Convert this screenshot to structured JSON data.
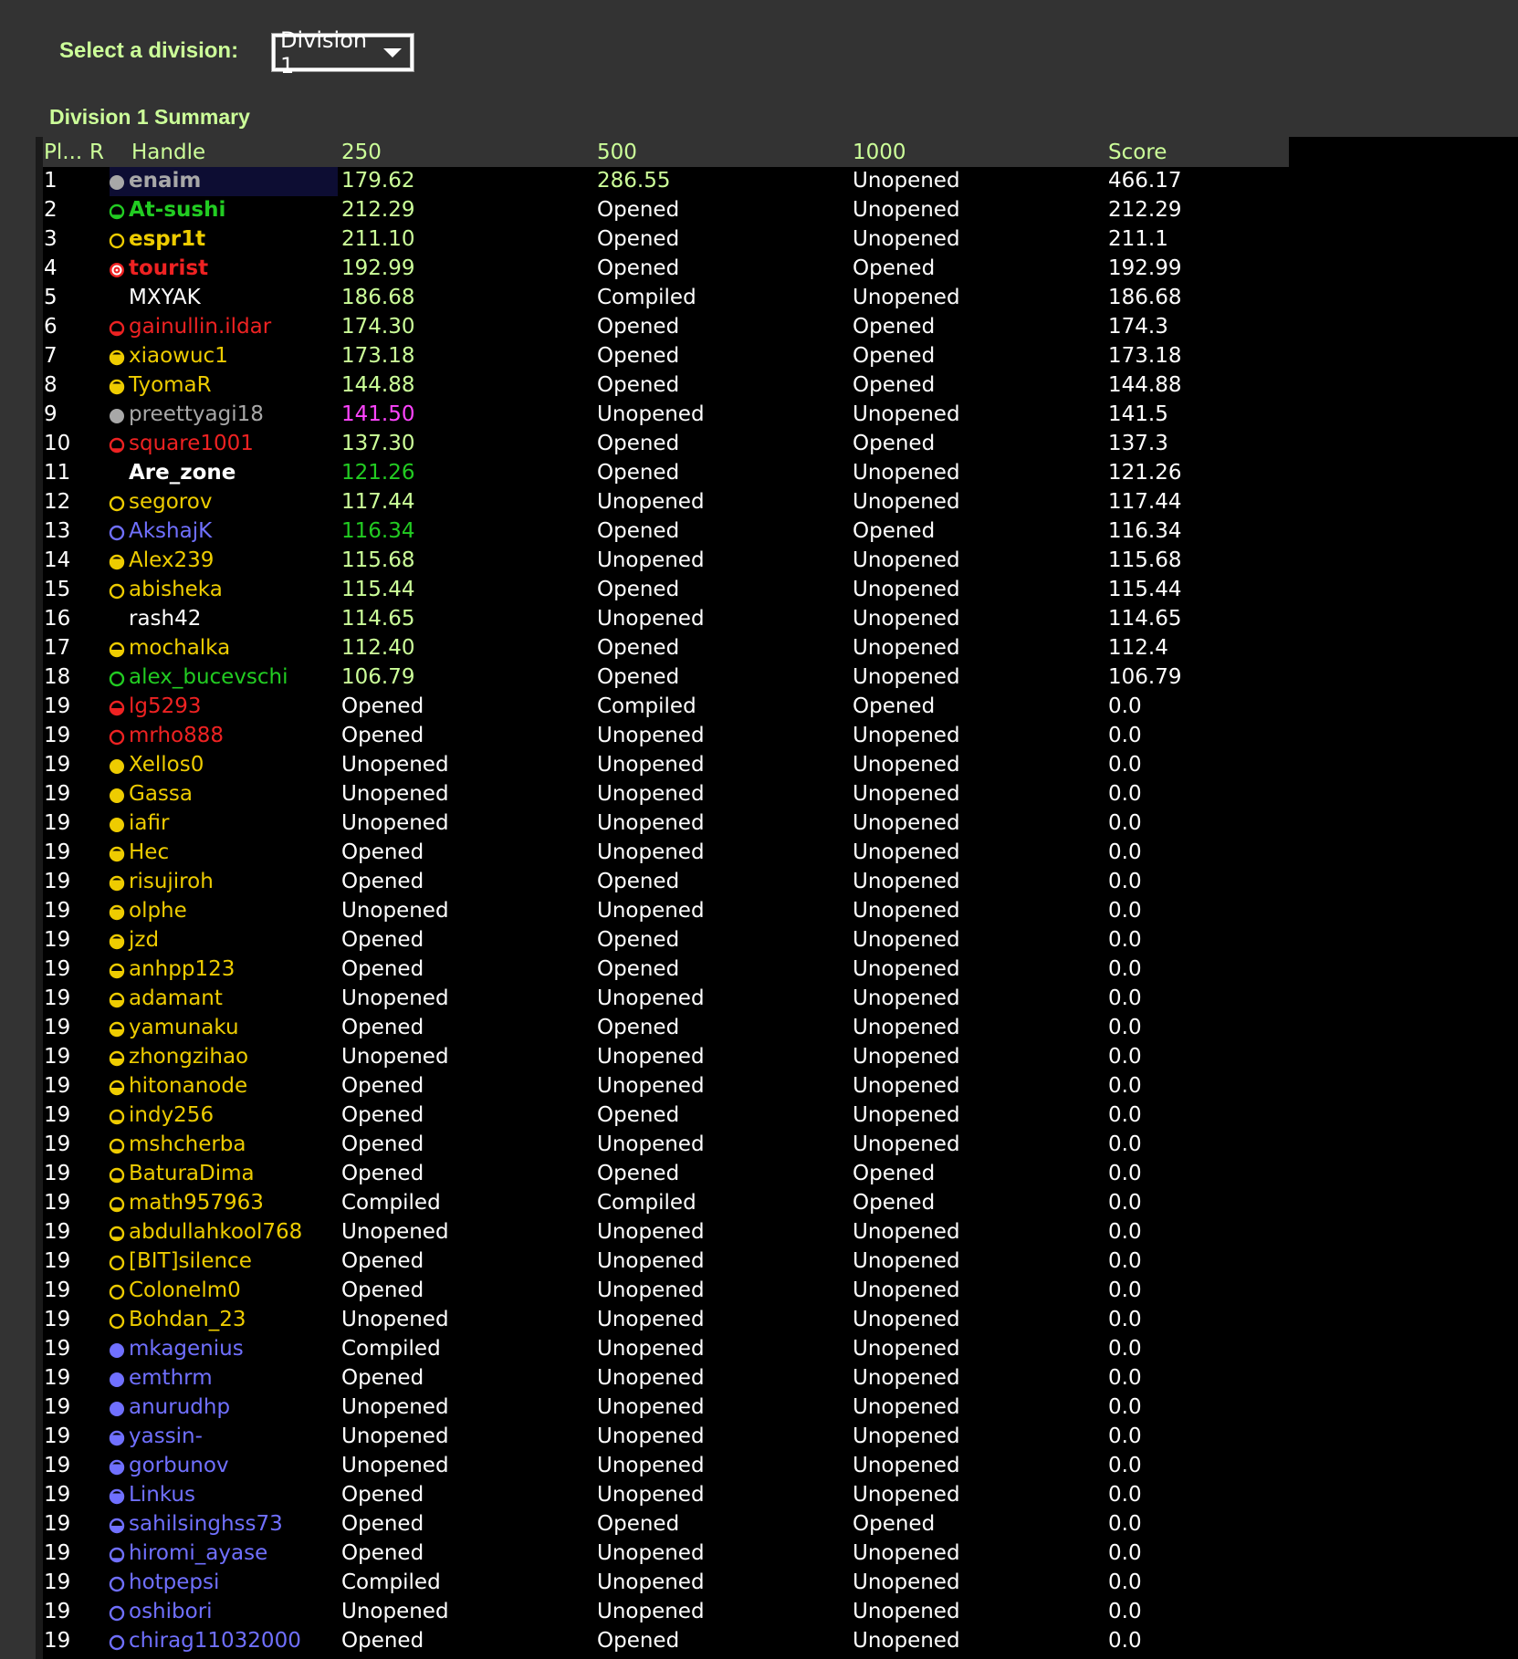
{
  "division_select": {
    "label": "Select a division:",
    "value": "Division 1"
  },
  "summary_title": "Division 1 Summary",
  "columns": [
    "Pl...",
    "R",
    "Handle",
    "250",
    "500",
    "1000",
    "Score"
  ],
  "colors": {
    "gray": "#a8a8a8",
    "green": "#22cc22",
    "yellow": "#eecc00",
    "red": "#ee2222",
    "blue": "#7070ff",
    "white": "#ffffff",
    "magenta": "#ff44ff",
    "text_green": "#ccff99"
  },
  "rows": [
    {
      "place": "1",
      "handle": "enaim",
      "icon": "gray",
      "fill": "full",
      "handle_color": "gray",
      "bold": true,
      "selected": true,
      "p250": "179.62",
      "p250_color": "text_green",
      "p500": "286.55",
      "p500_color": "text_green",
      "p1000": "Unopened",
      "score": "466.17"
    },
    {
      "place": "2",
      "handle": "At-sushi",
      "icon": "green",
      "fill": "top",
      "handle_color": "green",
      "bold": true,
      "p250": "212.29",
      "p250_color": "text_green",
      "p500": "Opened",
      "p1000": "Unopened",
      "score": "212.29"
    },
    {
      "place": "3",
      "handle": "espr1t",
      "icon": "yellow",
      "fill": "none",
      "handle_color": "yellow",
      "bold": true,
      "p250": "211.10",
      "p250_color": "text_green",
      "p500": "Opened",
      "p1000": "Unopened",
      "score": "211.1"
    },
    {
      "place": "4",
      "handle": "tourist",
      "icon": "red",
      "fill": "target",
      "handle_color": "red",
      "bold": true,
      "p250": "192.99",
      "p250_color": "text_green",
      "p500": "Opened",
      "p1000": "Opened",
      "score": "192.99"
    },
    {
      "place": "5",
      "handle": "MXYAK",
      "icon": "",
      "fill": "",
      "handle_color": "white",
      "p250": "186.68",
      "p250_color": "text_green",
      "p500": "Compiled",
      "p1000": "Unopened",
      "score": "186.68"
    },
    {
      "place": "6",
      "handle": "gainullin.ildar",
      "icon": "red",
      "fill": "top",
      "handle_color": "red",
      "p250": "174.30",
      "p250_color": "text_green",
      "p500": "Opened",
      "p1000": "Opened",
      "score": "174.3"
    },
    {
      "place": "7",
      "handle": "xiaowuc1",
      "icon": "yellow",
      "fill": "most",
      "handle_color": "yellow",
      "p250": "173.18",
      "p250_color": "text_green",
      "p500": "Opened",
      "p1000": "Opened",
      "score": "173.18"
    },
    {
      "place": "8",
      "handle": "TyomaR",
      "icon": "yellow",
      "fill": "most",
      "handle_color": "yellow",
      "p250": "144.88",
      "p250_color": "text_green",
      "p500": "Opened",
      "p1000": "Opened",
      "score": "144.88"
    },
    {
      "place": "9",
      "handle": "preettyagi18",
      "icon": "gray",
      "fill": "full",
      "handle_color": "gray",
      "p250": "141.50",
      "p250_color": "magenta",
      "p500": "Unopened",
      "p1000": "Unopened",
      "score": "141.5"
    },
    {
      "place": "10",
      "handle": "square1001",
      "icon": "red",
      "fill": "top",
      "handle_color": "red",
      "p250": "137.30",
      "p250_color": "text_green",
      "p500": "Opened",
      "p1000": "Opened",
      "score": "137.3"
    },
    {
      "place": "11",
      "handle": "Are_zone",
      "icon": "",
      "fill": "",
      "handle_color": "white",
      "bold": true,
      "p250": "121.26",
      "p250_color": "green",
      "p500": "Opened",
      "p1000": "Unopened",
      "score": "121.26"
    },
    {
      "place": "12",
      "handle": "segorov",
      "icon": "yellow",
      "fill": "none",
      "handle_color": "yellow",
      "p250": "117.44",
      "p250_color": "text_green",
      "p500": "Unopened",
      "p1000": "Unopened",
      "score": "117.44"
    },
    {
      "place": "13",
      "handle": "AkshajK",
      "icon": "blue",
      "fill": "none",
      "handle_color": "blue",
      "p250": "116.34",
      "p250_color": "green",
      "p500": "Opened",
      "p1000": "Opened",
      "score": "116.34"
    },
    {
      "place": "14",
      "handle": "Alex239",
      "icon": "yellow",
      "fill": "most",
      "handle_color": "yellow",
      "p250": "115.68",
      "p250_color": "text_green",
      "p500": "Unopened",
      "p1000": "Unopened",
      "score": "115.68"
    },
    {
      "place": "15",
      "handle": "abisheka",
      "icon": "yellow",
      "fill": "none",
      "handle_color": "yellow",
      "p250": "115.44",
      "p250_color": "text_green",
      "p500": "Opened",
      "p1000": "Unopened",
      "score": "115.44"
    },
    {
      "place": "16",
      "handle": "rash42",
      "icon": "",
      "fill": "",
      "handle_color": "white",
      "p250": "114.65",
      "p250_color": "text_green",
      "p500": "Unopened",
      "p1000": "Unopened",
      "score": "114.65"
    },
    {
      "place": "17",
      "handle": "mochalka",
      "icon": "yellow",
      "fill": "half",
      "handle_color": "yellow",
      "p250": "112.40",
      "p250_color": "text_green",
      "p500": "Opened",
      "p1000": "Unopened",
      "score": "112.4"
    },
    {
      "place": "18",
      "handle": "alex_bucevschi",
      "icon": "green",
      "fill": "none",
      "handle_color": "green",
      "p250": "106.79",
      "p250_color": "text_green",
      "p500": "Opened",
      "p1000": "Unopened",
      "score": "106.79"
    },
    {
      "place": "19",
      "handle": "lg5293",
      "icon": "red",
      "fill": "half",
      "handle_color": "red",
      "p250": "Opened",
      "p500": "Compiled",
      "p1000": "Opened",
      "score": "0.0"
    },
    {
      "place": "19",
      "handle": "mrho888",
      "icon": "red",
      "fill": "none",
      "handle_color": "red",
      "p250": "Opened",
      "p500": "Unopened",
      "p1000": "Unopened",
      "score": "0.0"
    },
    {
      "place": "19",
      "handle": "Xellos0",
      "icon": "yellow",
      "fill": "full",
      "handle_color": "yellow",
      "p250": "Unopened",
      "p500": "Unopened",
      "p1000": "Unopened",
      "score": "0.0"
    },
    {
      "place": "19",
      "handle": "Gassa",
      "icon": "yellow",
      "fill": "full",
      "handle_color": "yellow",
      "p250": "Unopened",
      "p500": "Unopened",
      "p1000": "Unopened",
      "score": "0.0"
    },
    {
      "place": "19",
      "handle": "iafir",
      "icon": "yellow",
      "fill": "full",
      "handle_color": "yellow",
      "p250": "Unopened",
      "p500": "Unopened",
      "p1000": "Unopened",
      "score": "0.0"
    },
    {
      "place": "19",
      "handle": "Hec",
      "icon": "yellow",
      "fill": "most",
      "handle_color": "yellow",
      "p250": "Opened",
      "p500": "Unopened",
      "p1000": "Unopened",
      "score": "0.0"
    },
    {
      "place": "19",
      "handle": "risujiroh",
      "icon": "yellow",
      "fill": "most",
      "handle_color": "yellow",
      "p250": "Opened",
      "p500": "Opened",
      "p1000": "Unopened",
      "score": "0.0"
    },
    {
      "place": "19",
      "handle": "olphe",
      "icon": "yellow",
      "fill": "most",
      "handle_color": "yellow",
      "p250": "Unopened",
      "p500": "Unopened",
      "p1000": "Unopened",
      "score": "0.0"
    },
    {
      "place": "19",
      "handle": "jzd",
      "icon": "yellow",
      "fill": "most",
      "handle_color": "yellow",
      "p250": "Opened",
      "p500": "Opened",
      "p1000": "Unopened",
      "score": "0.0"
    },
    {
      "place": "19",
      "handle": "anhpp123",
      "icon": "yellow",
      "fill": "half",
      "handle_color": "yellow",
      "p250": "Opened",
      "p500": "Opened",
      "p1000": "Unopened",
      "score": "0.0"
    },
    {
      "place": "19",
      "handle": "adamant",
      "icon": "yellow",
      "fill": "half",
      "handle_color": "yellow",
      "p250": "Unopened",
      "p500": "Unopened",
      "p1000": "Unopened",
      "score": "0.0"
    },
    {
      "place": "19",
      "handle": "yamunaku",
      "icon": "yellow",
      "fill": "half",
      "handle_color": "yellow",
      "p250": "Opened",
      "p500": "Opened",
      "p1000": "Unopened",
      "score": "0.0"
    },
    {
      "place": "19",
      "handle": "zhongzihao",
      "icon": "yellow",
      "fill": "half",
      "handle_color": "yellow",
      "p250": "Unopened",
      "p500": "Unopened",
      "p1000": "Unopened",
      "score": "0.0"
    },
    {
      "place": "19",
      "handle": "hitonanode",
      "icon": "yellow",
      "fill": "half",
      "handle_color": "yellow",
      "p250": "Opened",
      "p500": "Unopened",
      "p1000": "Unopened",
      "score": "0.0"
    },
    {
      "place": "19",
      "handle": "indy256",
      "icon": "yellow",
      "fill": "top",
      "handle_color": "yellow",
      "p250": "Opened",
      "p500": "Opened",
      "p1000": "Unopened",
      "score": "0.0"
    },
    {
      "place": "19",
      "handle": "mshcherba",
      "icon": "yellow",
      "fill": "top",
      "handle_color": "yellow",
      "p250": "Opened",
      "p500": "Unopened",
      "p1000": "Unopened",
      "score": "0.0"
    },
    {
      "place": "19",
      "handle": "BaturaDima",
      "icon": "yellow",
      "fill": "top",
      "handle_color": "yellow",
      "p250": "Opened",
      "p500": "Opened",
      "p1000": "Opened",
      "score": "0.0"
    },
    {
      "place": "19",
      "handle": "math957963",
      "icon": "yellow",
      "fill": "top",
      "handle_color": "yellow",
      "p250": "Compiled",
      "p500": "Compiled",
      "p1000": "Opened",
      "score": "0.0"
    },
    {
      "place": "19",
      "handle": "abdullahkool768",
      "icon": "yellow",
      "fill": "top",
      "handle_color": "yellow",
      "p250": "Unopened",
      "p500": "Unopened",
      "p1000": "Unopened",
      "score": "0.0"
    },
    {
      "place": "19",
      "handle": "[BIT]silence",
      "icon": "yellow",
      "fill": "none",
      "handle_color": "yellow",
      "p250": "Opened",
      "p500": "Unopened",
      "p1000": "Unopened",
      "score": "0.0"
    },
    {
      "place": "19",
      "handle": "Colonelm0",
      "icon": "yellow",
      "fill": "none",
      "handle_color": "yellow",
      "p250": "Opened",
      "p500": "Unopened",
      "p1000": "Unopened",
      "score": "0.0"
    },
    {
      "place": "19",
      "handle": "Bohdan_23",
      "icon": "yellow",
      "fill": "none",
      "handle_color": "yellow",
      "p250": "Unopened",
      "p500": "Unopened",
      "p1000": "Unopened",
      "score": "0.0"
    },
    {
      "place": "19",
      "handle": "mkagenius",
      "icon": "blue",
      "fill": "full",
      "handle_color": "blue",
      "p250": "Compiled",
      "p500": "Unopened",
      "p1000": "Unopened",
      "score": "0.0"
    },
    {
      "place": "19",
      "handle": "emthrm",
      "icon": "blue",
      "fill": "full",
      "handle_color": "blue",
      "p250": "Opened",
      "p500": "Unopened",
      "p1000": "Unopened",
      "score": "0.0"
    },
    {
      "place": "19",
      "handle": "anurudhp",
      "icon": "blue",
      "fill": "full",
      "handle_color": "blue",
      "p250": "Unopened",
      "p500": "Unopened",
      "p1000": "Unopened",
      "score": "0.0"
    },
    {
      "place": "19",
      "handle": "yassin-",
      "icon": "blue",
      "fill": "most",
      "handle_color": "blue",
      "p250": "Unopened",
      "p500": "Unopened",
      "p1000": "Unopened",
      "score": "0.0"
    },
    {
      "place": "19",
      "handle": "gorbunov",
      "icon": "blue",
      "fill": "most",
      "handle_color": "blue",
      "p250": "Unopened",
      "p500": "Unopened",
      "p1000": "Unopened",
      "score": "0.0"
    },
    {
      "place": "19",
      "handle": "Linkus",
      "icon": "blue",
      "fill": "most",
      "handle_color": "blue",
      "p250": "Opened",
      "p500": "Unopened",
      "p1000": "Unopened",
      "score": "0.0"
    },
    {
      "place": "19",
      "handle": "sahilsinghss73",
      "icon": "blue",
      "fill": "half",
      "handle_color": "blue",
      "p250": "Opened",
      "p500": "Opened",
      "p1000": "Opened",
      "score": "0.0"
    },
    {
      "place": "19",
      "handle": "hiromi_ayase",
      "icon": "blue",
      "fill": "top",
      "handle_color": "blue",
      "p250": "Opened",
      "p500": "Unopened",
      "p1000": "Unopened",
      "score": "0.0"
    },
    {
      "place": "19",
      "handle": "hotpepsi",
      "icon": "blue",
      "fill": "none",
      "handle_color": "blue",
      "p250": "Compiled",
      "p500": "Unopened",
      "p1000": "Unopened",
      "score": "0.0"
    },
    {
      "place": "19",
      "handle": "oshibori",
      "icon": "blue",
      "fill": "none",
      "handle_color": "blue",
      "p250": "Unopened",
      "p500": "Unopened",
      "p1000": "Unopened",
      "score": "0.0"
    },
    {
      "place": "19",
      "handle": "chirag11032000",
      "icon": "blue",
      "fill": "none",
      "handle_color": "blue",
      "p250": "Opened",
      "p500": "Opened",
      "p1000": "Unopened",
      "score": "0.0"
    }
  ]
}
